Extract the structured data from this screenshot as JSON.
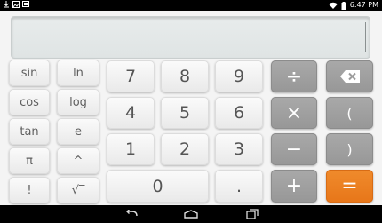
{
  "status_bar": {
    "time": "6:47 PM",
    "left_icons": [
      "download-icon",
      "image-icon",
      "cast-icon"
    ],
    "right_icons": [
      "wifi-icon",
      "battery-icon"
    ]
  },
  "display": {
    "value": ""
  },
  "keys": {
    "sin": "sin",
    "ln": "ln",
    "cos": "cos",
    "log": "log",
    "tan": "tan",
    "e": "e",
    "pi": "π",
    "power": "^",
    "factorial": "!",
    "sqrt": "√‾",
    "n7": "7",
    "n8": "8",
    "n9": "9",
    "n4": "4",
    "n5": "5",
    "n6": "6",
    "n1": "1",
    "n2": "2",
    "n3": "3",
    "n0": "0",
    "dot": ".",
    "divide": "÷",
    "multiply": "×",
    "minus": "−",
    "plus": "+",
    "lparen": "(",
    "rparen": ")",
    "equals": "="
  },
  "colors": {
    "operator": "#a0a0a0",
    "equals": "#ec8024",
    "background": "#f4f4f4"
  },
  "nav_bar": {
    "buttons": [
      "back-icon",
      "home-icon",
      "recents-icon"
    ]
  }
}
